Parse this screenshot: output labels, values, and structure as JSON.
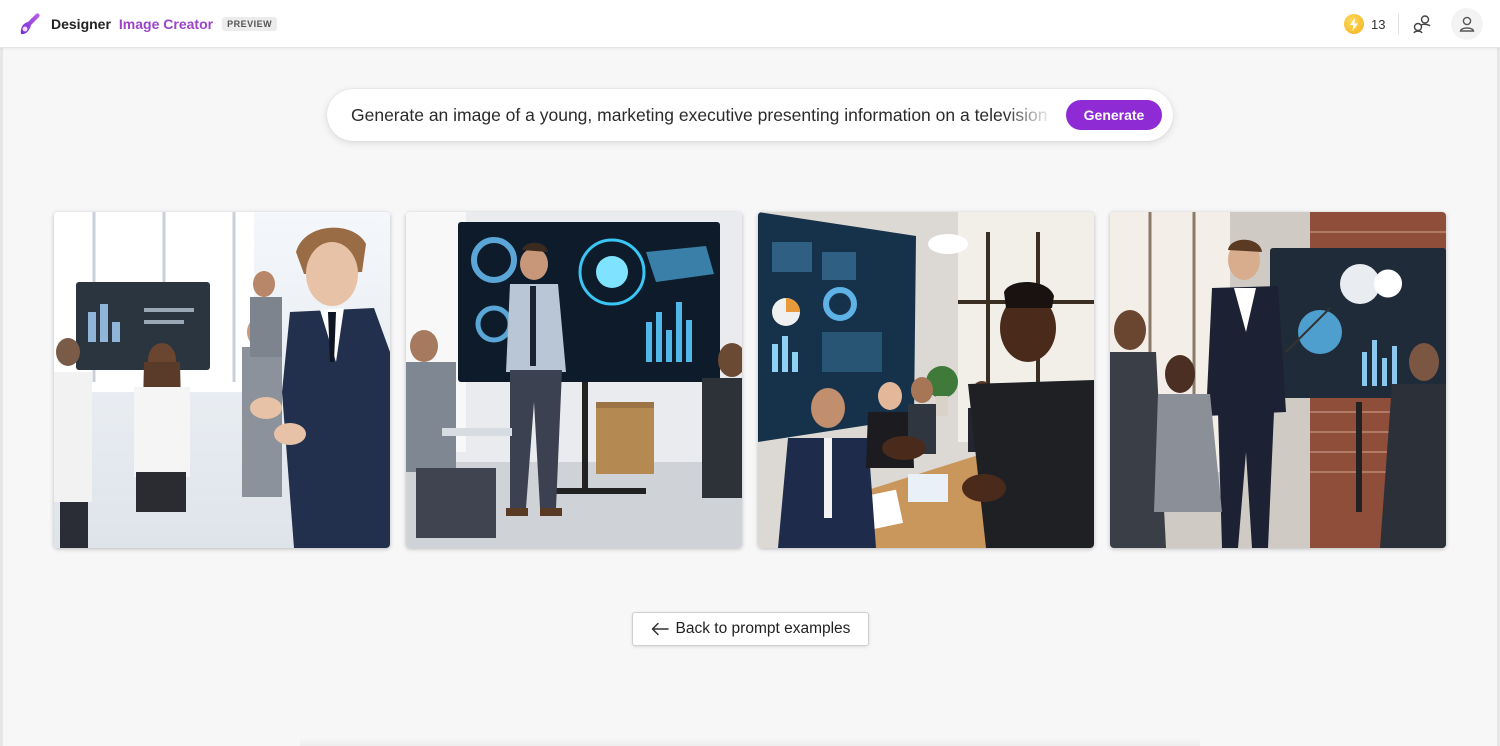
{
  "header": {
    "brand_name": "Designer",
    "product_name": "Image Creator",
    "badge": "PREVIEW",
    "boosts": {
      "icon": "lightning-bolt-icon",
      "count": "13"
    },
    "share_icon": "share-icon",
    "profile_icon": "user-profile-icon"
  },
  "prompt": {
    "value": "Generate an image of a young, marketing executive presenting information on a television",
    "generate_label": "Generate"
  },
  "results": [
    {
      "name": "result-image-1",
      "description_icon": "image-thumbnail"
    },
    {
      "name": "result-image-2",
      "description_icon": "image-thumbnail"
    },
    {
      "name": "result-image-3",
      "description_icon": "image-thumbnail"
    },
    {
      "name": "result-image-4",
      "description_icon": "image-thumbnail"
    }
  ],
  "back_button": {
    "label": "Back to prompt examples",
    "icon": "arrow-left-icon"
  },
  "colors": {
    "accent": "#8f2bd4",
    "brand_product": "#9b44c8",
    "boost": "#f2b01e",
    "background": "#f7f7f8"
  }
}
